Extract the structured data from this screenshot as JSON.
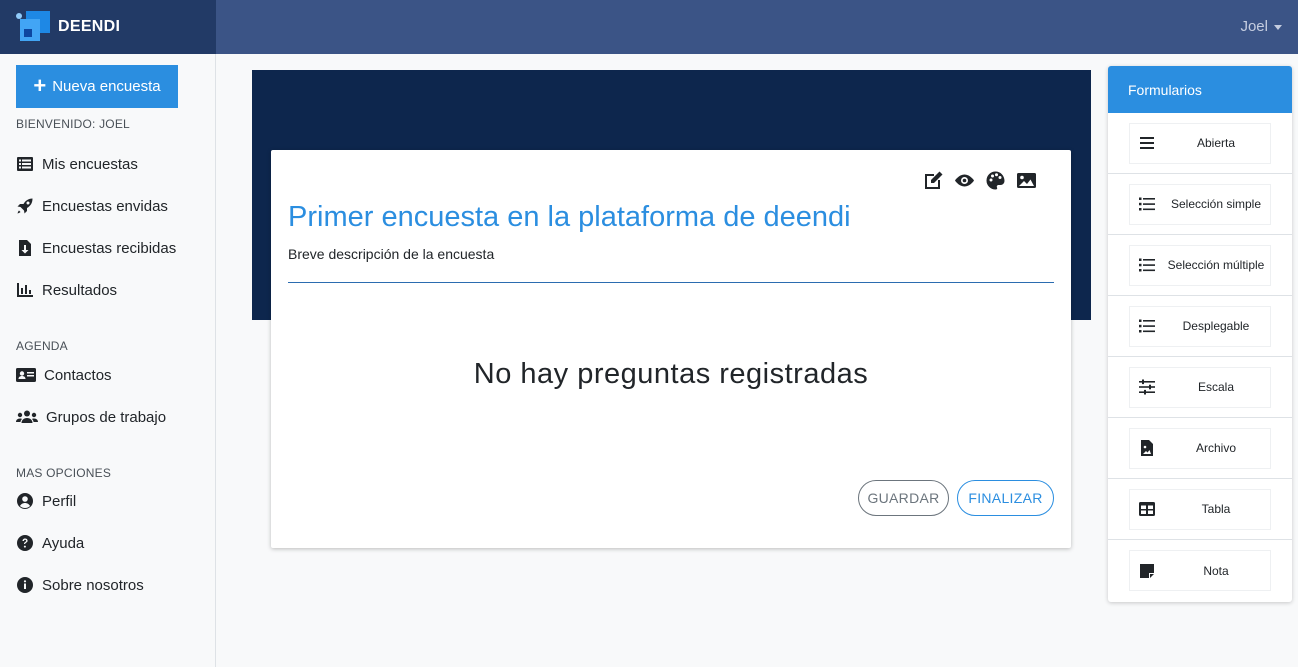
{
  "brand": {
    "name": "DEENDI"
  },
  "user_menu": {
    "name": "Joel"
  },
  "sidebar": {
    "new_survey_label": "Nueva encuesta",
    "welcome": "BIENVENIDO: JOEL",
    "main_items": [
      {
        "label": "Mis encuestas",
        "icon": "list-icon"
      },
      {
        "label": "Encuestas envidas",
        "icon": "rocket-icon"
      },
      {
        "label": "Encuestas recibidas",
        "icon": "file-download-icon"
      },
      {
        "label": "Resultados",
        "icon": "chart-bar-icon"
      }
    ],
    "agenda_label": "AGENDA",
    "agenda_items": [
      {
        "label": "Contactos",
        "icon": "address-card-icon"
      },
      {
        "label": "Grupos de trabajo",
        "icon": "users-icon"
      }
    ],
    "more_label": "MAS OPCIONES",
    "more_items": [
      {
        "label": "Perfil",
        "icon": "user-circle-icon"
      },
      {
        "label": "Ayuda",
        "icon": "question-circle-icon"
      },
      {
        "label": "Sobre nosotros",
        "icon": "info-circle-icon"
      }
    ]
  },
  "survey": {
    "title": "Primer encuesta en la plataforma de deendi",
    "description": "Breve descripción de la encuesta",
    "empty_message": "No hay preguntas registradas",
    "tools": [
      "edit-icon",
      "eye-icon",
      "palette-icon",
      "image-icon"
    ],
    "save_label": "GUARDAR",
    "finish_label": "FINALIZAR"
  },
  "forms_panel": {
    "header": "Formularios",
    "items": [
      {
        "label": "Abierta",
        "icon": "bars-icon"
      },
      {
        "label": "Selección simple",
        "icon": "list-icon"
      },
      {
        "label": "Selección múltiple",
        "icon": "list-icon"
      },
      {
        "label": "Desplegable",
        "icon": "list-icon"
      },
      {
        "label": "Escala",
        "icon": "sliders-icon"
      },
      {
        "label": "Archivo",
        "icon": "file-image-icon"
      },
      {
        "label": "Tabla",
        "icon": "table-icon"
      },
      {
        "label": "Nota",
        "icon": "sticky-note-icon"
      }
    ]
  },
  "colors": {
    "topbar": "#3b5486",
    "brand_bg": "#223a66",
    "accent": "#2b8ee0",
    "banner": "#0d264d"
  }
}
